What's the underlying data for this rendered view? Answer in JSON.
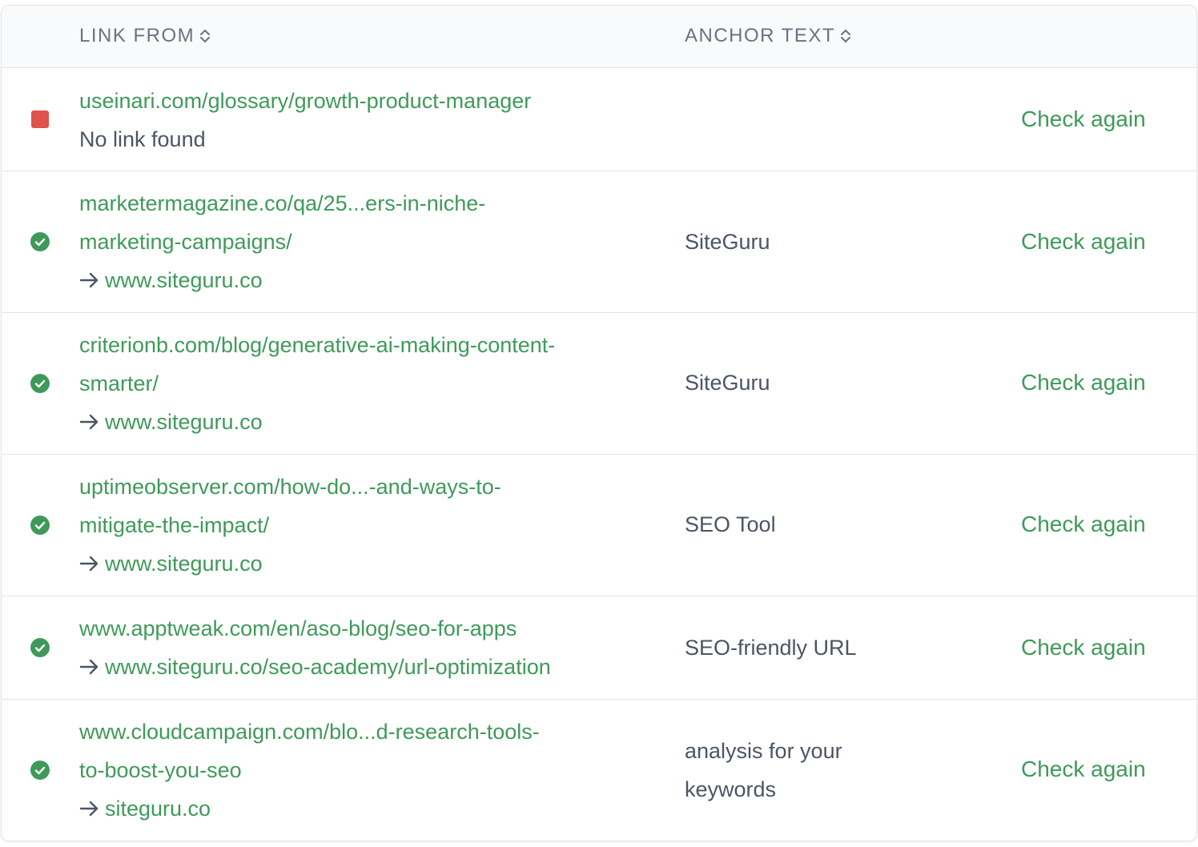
{
  "header": {
    "link_from": "LINK FROM",
    "anchor_text": "ANCHOR TEXT"
  },
  "colors": {
    "accent": "#3f9a5a",
    "fail": "#e0524d",
    "text": "#4b5563"
  },
  "rows": [
    {
      "status": "fail",
      "source_lines": [
        "useinari.com/glossary/growth-product-manager"
      ],
      "note": "No link found",
      "target": "",
      "anchor_lines": [],
      "action": "Check again"
    },
    {
      "status": "ok",
      "source_lines": [
        "marketermagazine.co/qa/25...ers-in-niche-",
        "marketing-campaigns/"
      ],
      "target": "www.siteguru.co",
      "anchor_lines": [
        "SiteGuru"
      ],
      "action": "Check again"
    },
    {
      "status": "ok",
      "source_lines": [
        "criterionb.com/blog/generative-ai-making-content-",
        "smarter/"
      ],
      "target": "www.siteguru.co",
      "anchor_lines": [
        "SiteGuru"
      ],
      "action": "Check again"
    },
    {
      "status": "ok",
      "source_lines": [
        "uptimeobserver.com/how-do...-and-ways-to-",
        "mitigate-the-impact/"
      ],
      "target": "www.siteguru.co",
      "anchor_lines": [
        "SEO Tool"
      ],
      "action": "Check again"
    },
    {
      "status": "ok",
      "source_lines": [
        "www.apptweak.com/en/aso-blog/seo-for-apps"
      ],
      "target": "www.siteguru.co/seo-academy/url-optimization",
      "anchor_lines": [
        "SEO-friendly URL"
      ],
      "action": "Check again"
    },
    {
      "status": "ok",
      "source_lines": [
        "www.cloudcampaign.com/blo...d-research-tools-",
        "to-boost-you-seo"
      ],
      "target": "siteguru.co",
      "anchor_lines": [
        "analysis for your",
        "keywords"
      ],
      "action": "Check again"
    }
  ]
}
